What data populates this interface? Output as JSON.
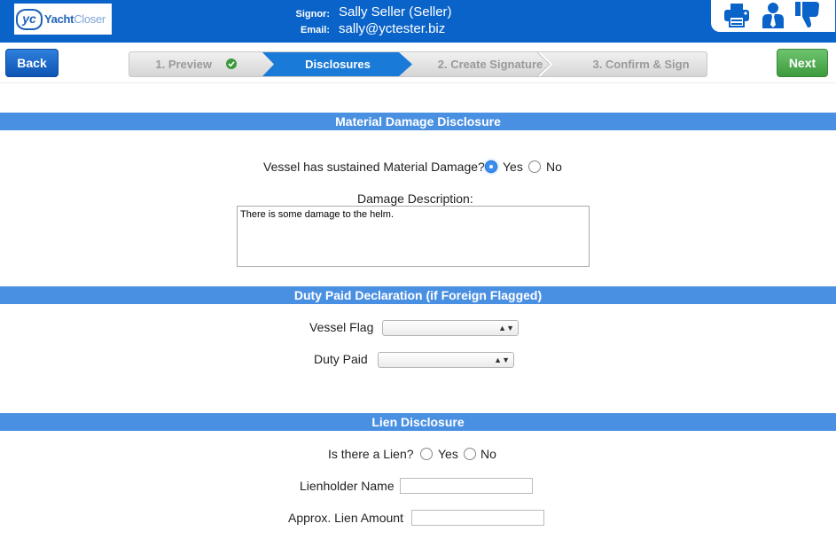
{
  "header": {
    "logo": {
      "mark": "yc",
      "name_bold": "Yacht",
      "name_light": "Closer"
    },
    "signer": {
      "signor_label": "Signor:",
      "email_label": "Email:",
      "signor_value": "Sally Seller (Seller)",
      "email_value": "sally@yctester.biz"
    },
    "icons": [
      "printer-icon",
      "user-tie-icon",
      "thumbs-down-icon"
    ]
  },
  "nav": {
    "back_label": "Back",
    "next_label": "Next",
    "steps": [
      {
        "label": "1. Preview",
        "state": "done"
      },
      {
        "label": "Disclosures",
        "state": "active"
      },
      {
        "label": "2. Create Signature",
        "state": "pending"
      },
      {
        "label": "3. Confirm & Sign",
        "state": "pending"
      }
    ]
  },
  "material_damage": {
    "title": "Material Damage Disclosure",
    "question": "Vessel has sustained Material Damage?",
    "yes": "Yes",
    "no": "No",
    "selected": "Yes",
    "description_label": "Damage Description:",
    "description_value": "There is some damage to the helm."
  },
  "duty_paid": {
    "title": "Duty Paid Declaration (if Foreign Flagged)",
    "vessel_flag_label": "Vessel Flag",
    "vessel_flag_value": "",
    "duty_paid_label": "Duty Paid",
    "duty_paid_value": ""
  },
  "lien": {
    "title": "Lien Disclosure",
    "question": "Is there a Lien?",
    "yes": "Yes",
    "no": "No",
    "lienholder_label": "Lienholder Name",
    "lienholder_value": "",
    "amount_label": "Approx. Lien Amount",
    "amount_value": ""
  },
  "colors": {
    "header_blue": "#0a63c9",
    "section_blue": "#4a90e2",
    "next_green": "#4caf50",
    "step_active": "#1a7ad8",
    "check_green": "#3c9a3c"
  }
}
